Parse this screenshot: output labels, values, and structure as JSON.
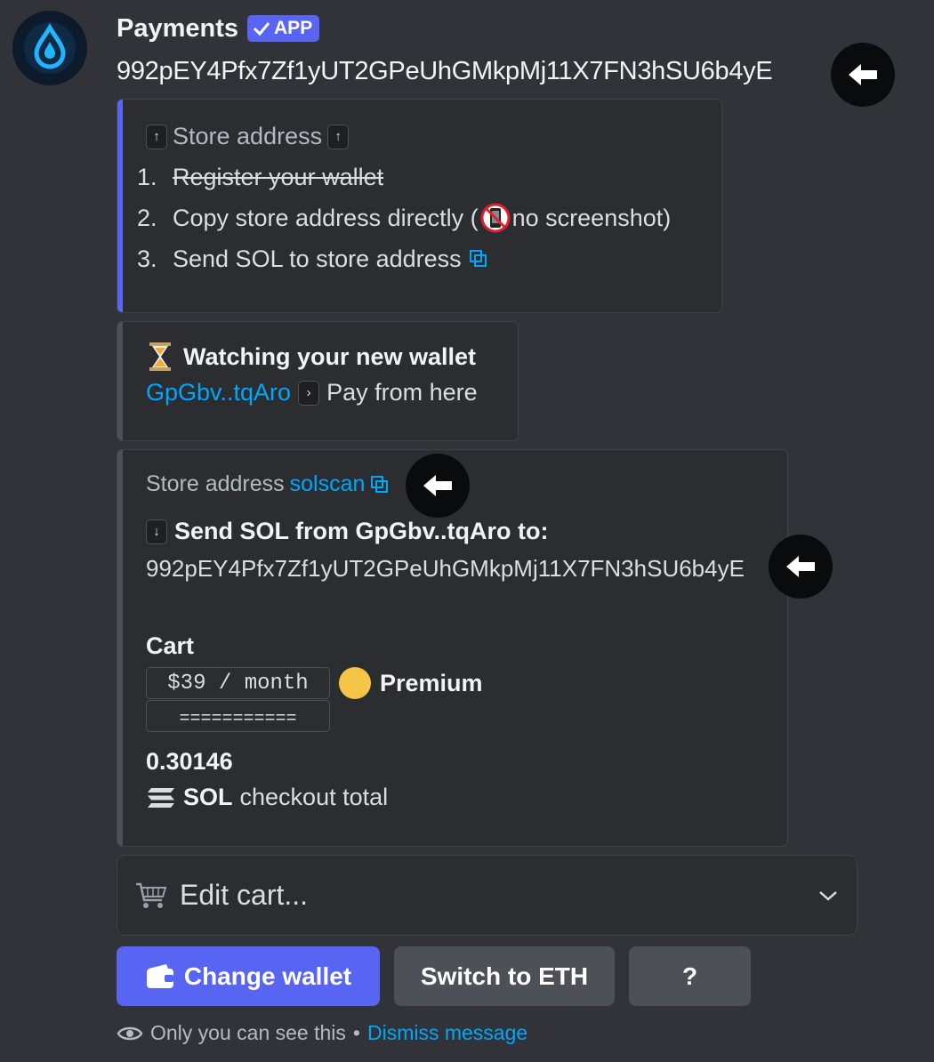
{
  "message": {
    "author": "Payments",
    "badge": "APP",
    "address": "992pEY4Pfx7Zf1yUT2GPeUhGMkpMj11X7FN3hSU6b4yE"
  },
  "embed1": {
    "accent_color": "#5865f2",
    "heading": "Store address",
    "steps": [
      {
        "num": "1.",
        "text": "Register your wallet"
      },
      {
        "num": "2.",
        "text_before": "Copy store address directly (",
        "text_after": " no screenshot)"
      },
      {
        "num": "3.",
        "text": "Send SOL to store address"
      }
    ]
  },
  "embed2": {
    "title": "Watching your new wallet",
    "wallet_short": "GpGbv..tqAro",
    "pay_text": "Pay from here"
  },
  "embed3": {
    "label": "Store address",
    "link": "solscan",
    "send_title": "Send SOL from GpGbv..tqAro to:",
    "address": "992pEY4Pfx7Zf1yUT2GPeUhGMkpMj11X7FN3hSU6b4yE",
    "cart_title": "Cart",
    "price": "$39 / month",
    "plan": "Premium",
    "separator": "===========",
    "total": "0.30146",
    "currency": "SOL",
    "total_label": "checkout total"
  },
  "select": {
    "placeholder": "Edit cart..."
  },
  "buttons": {
    "change_wallet": "Change wallet",
    "switch": "Switch to ETH",
    "help": "?"
  },
  "footer": {
    "note": "Only you can see this",
    "dot": "•",
    "dismiss": "Dismiss message"
  },
  "colors": {
    "blurple": "#5865f2",
    "link": "#00a8fc",
    "premium_dot": "#f5c645"
  }
}
